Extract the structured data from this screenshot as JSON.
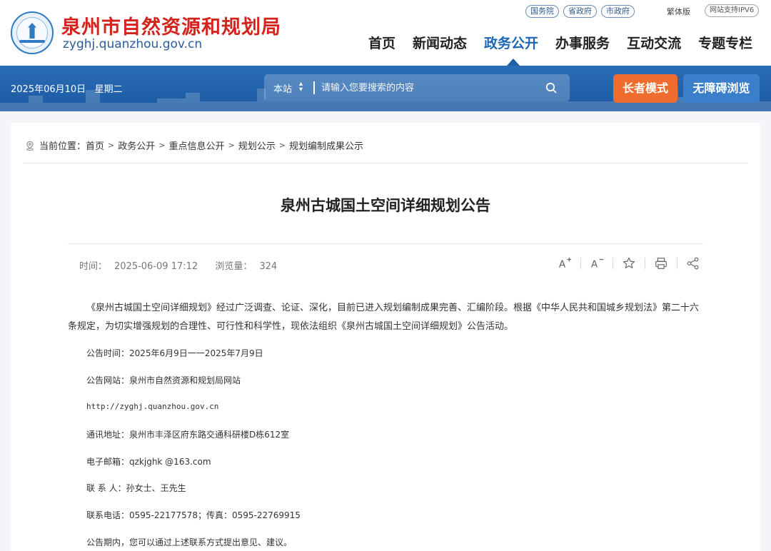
{
  "header": {
    "site_title": "泉州市自然资源和规划局",
    "site_domain": "zyghj.quanzhou.gov.cn",
    "top_links": [
      "国务院",
      "省政府",
      "市政府"
    ],
    "traditional": "繁体版",
    "ipv6": "网站支持IPV6",
    "nav": [
      "首页",
      "新闻动态",
      "政务公开",
      "办事服务",
      "互动交流",
      "专题专栏"
    ],
    "active_nav": "政务公开"
  },
  "toolbar": {
    "date": "2025年06月10日",
    "weekday": "星期二",
    "search_scope": "本站",
    "search_placeholder": "请输入您要搜索的内容",
    "elder_mode": "长者模式",
    "accessible_browse": "无障碍浏览"
  },
  "breadcrumb": {
    "label": "当前位置：",
    "items": [
      "首页",
      "政务公开",
      "重点信息公开",
      "规划公示",
      "规划编制成果公示"
    ]
  },
  "article": {
    "title": "泉州古城国土空间详细规划公告",
    "time_label": "时间：",
    "time": "2025-06-09 17:12",
    "views_label": "浏览量：",
    "views": "324",
    "intro_line1": "《泉州古城国土空间详细规划》经过广泛调查、论证、深化，目前已进入规划编制成果完善、汇编阶段。根据《中华人民共和国城乡规划法》第二十六",
    "intro_line2": "条规定，为切实增强规划的合理性、可行性和科学性，现依法组织《泉州古城国土空间详细规划》公告活动。",
    "lines": [
      "公告时间：2025年6月9日一一2025年7月9日",
      "公告网站：泉州市自然资源和规划局网站",
      "http://zyghj.quanzhou.gov.cn",
      "通讯地址：泉州市丰泽区府东路交通科研楼D栋612室",
      "电子邮箱：qzkjghk  @163.com",
      "联  系  人：孙女士、王先生",
      "联系电话：0595-22177578；传真：0595-22769915",
      "公告期内，您可以通过上述联系方式提出意见、建议。"
    ]
  },
  "colors": {
    "brand_red": "#d4231c",
    "nav_blue": "#1c66b3",
    "bar_blue": "#1b5aa2",
    "elder_orange": "#f06c2e"
  }
}
